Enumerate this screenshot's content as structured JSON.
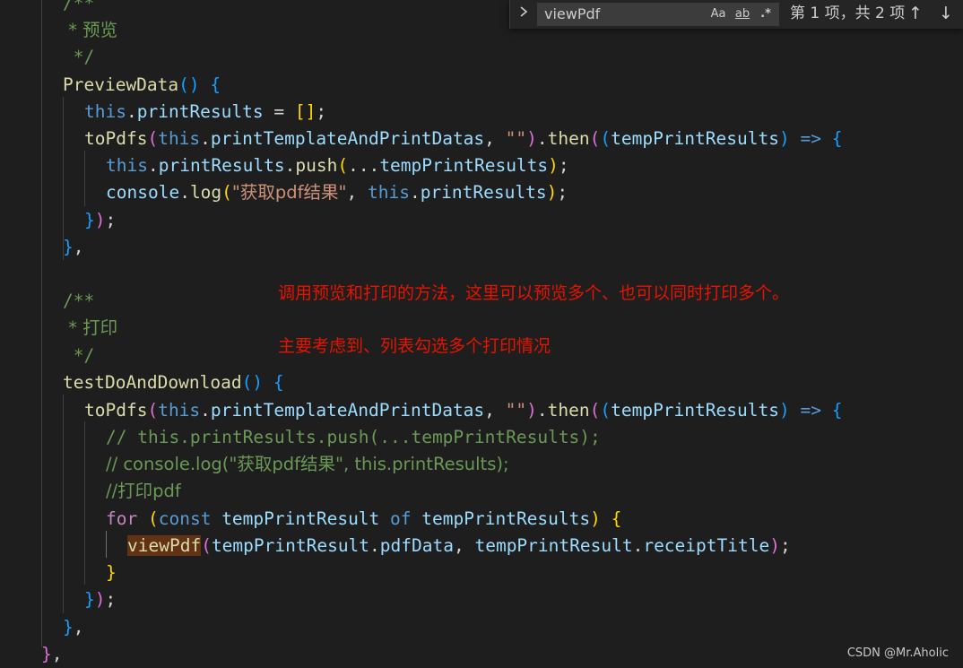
{
  "find_widget": {
    "query": "viewPdf",
    "match_case_label": "Aa",
    "whole_word_label": "ab",
    "regex_label": ".*",
    "result_count": "第 1 项，共 2 项",
    "toggle_icon": "chevron-right-icon",
    "prev_icon": "arrow-up-icon",
    "next_icon": "arrow-down-icon"
  },
  "code": {
    "l1": "/**",
    "l2": " * 预览",
    "l3": " */",
    "l4_fn": "PreviewData",
    "l5_this": "this",
    "l5_prop": "printResults",
    "l6_fn": "toPdfs",
    "l6_prop": "printTemplateAndPrintDatas",
    "l6_str": "\"\"",
    "l6_then": "then",
    "l6_param": "tempPrintResults",
    "l7_this": "this",
    "l7_prop": "printResults",
    "l7_fn": "push",
    "l7_arg": "tempPrintResults",
    "l8_obj": "console",
    "l8_fn": "log",
    "l8_str": "\"获取pdf结果\"",
    "l8_this": "this",
    "l8_prop": "printResults",
    "l11": "/**",
    "l12": " * 打印",
    "l13": " */",
    "l14_fn": "testDoAndDownload",
    "l15_fn": "toPdfs",
    "l15_prop": "printTemplateAndPrintDatas",
    "l15_str": "\"\"",
    "l15_then": "then",
    "l15_param": "tempPrintResults",
    "l16": "// this.printResults.push(...tempPrintResults);",
    "l17": "// console.log(\"获取pdf结果\", this.printResults);",
    "l18": "//打印pdf",
    "l19_for": "for",
    "l19_const": "const",
    "l19_var": "tempPrintResult",
    "l19_of": "of",
    "l19_iter": "tempPrintResults",
    "l20_fn": "viewPdf",
    "l20_a": "tempPrintResult",
    "l20_ap": "pdfData",
    "l20_b": "tempPrintResult",
    "l20_bp": "receiptTitle"
  },
  "annotation": {
    "line1": "调用预览和打印的方法，这里可以预览多个、也可以同时打印多个。",
    "line2": "主要考虑到、列表勾选多个打印情况"
  },
  "watermark": "CSDN @Mr.Aholic"
}
